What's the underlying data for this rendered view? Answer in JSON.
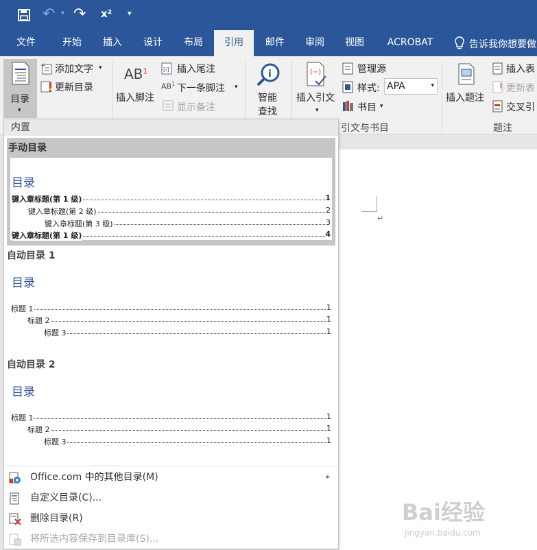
{
  "qat": {
    "undo_glyph": "↶",
    "redo_glyph": "↷",
    "superscript_glyph": "x²",
    "customize_glyph": "▾"
  },
  "tabs": [
    {
      "label": "文件"
    },
    {
      "label": "开始"
    },
    {
      "label": "插入"
    },
    {
      "label": "设计"
    },
    {
      "label": "布局"
    },
    {
      "label": "引用",
      "active": true
    },
    {
      "label": "邮件"
    },
    {
      "label": "审阅"
    },
    {
      "label": "视图"
    },
    {
      "label": "ACROBAT"
    }
  ],
  "tell_me": "告诉我你想要做",
  "ribbon": {
    "toc_button": "目录",
    "add_text": "添加文字",
    "update_toc": "更新目录",
    "insert_footnote": "插入脚注",
    "footnote_glyph": "AB",
    "footnote_sup": "1",
    "insert_endnote": "插入尾注",
    "next_footnote": "下一条脚注",
    "show_notes": "显示备注",
    "smart_lookup_1": "智能",
    "smart_lookup_2": "查找",
    "insert_citation": "插入引文",
    "manage_sources": "管理源",
    "style_label": "样式:",
    "style_value": "APA",
    "bibliography": "书目",
    "citations_group": "引文与书目",
    "insert_caption": "插入题注",
    "insert_table_of_figures": "插入表",
    "update_table": "更新表",
    "cross_reference": "交叉引",
    "captions_group": "题注"
  },
  "menu": {
    "header": "内置",
    "sections": [
      {
        "title": "手动目录",
        "toc_title": "目录",
        "lines": [
          {
            "text": "键入章标题(第 1 级)",
            "page": "1",
            "level": 1,
            "bold": true
          },
          {
            "text": "键入章标题(第 2 级)",
            "page": "2",
            "level": 2,
            "bold": false
          },
          {
            "text": "键入章标题(第 3 级)",
            "page": "3",
            "level": 3,
            "bold": false
          },
          {
            "text": "键入章标题(第 1 级)",
            "page": "4",
            "level": 1,
            "bold": true
          }
        ]
      },
      {
        "title": "自动目录 1",
        "toc_title": "目录",
        "lines": [
          {
            "text": "标题 1",
            "page": "1",
            "level": 1,
            "bold": false
          },
          {
            "text": "标题 2",
            "page": "1",
            "level": 2,
            "bold": false
          },
          {
            "text": "标题 3",
            "page": "1",
            "level": 3,
            "bold": false
          }
        ]
      },
      {
        "title": "自动目录 2",
        "toc_title": "目录",
        "lines": [
          {
            "text": "标题 1",
            "page": "1",
            "level": 1,
            "bold": false
          },
          {
            "text": "标题 2",
            "page": "1",
            "level": 2,
            "bold": false
          },
          {
            "text": "标题 3",
            "page": "1",
            "level": 3,
            "bold": false
          }
        ]
      }
    ],
    "items": [
      {
        "label": "Office.com 中的其他目录(M)",
        "icon": "office-toc-icon",
        "arrow": "▸",
        "disabled": false
      },
      {
        "label": "自定义目录(C)...",
        "icon": "custom-toc-icon",
        "disabled": false
      },
      {
        "label": "删除目录(R)",
        "icon": "remove-toc-icon",
        "disabled": false
      },
      {
        "label": "将所选内容保存到目录库(S)...",
        "icon": "save-selection-icon",
        "disabled": true
      }
    ]
  },
  "doc": {
    "paragraph_mark": "↵"
  },
  "watermark": {
    "text": "Bai经验",
    "sub": "jingyan.baidu.com"
  },
  "colors": {
    "title_bar": "#2b579a",
    "ribbon": "#f1f1f1",
    "selected_gallery": "#c6c6c6",
    "toc_title": "#2f5597"
  }
}
